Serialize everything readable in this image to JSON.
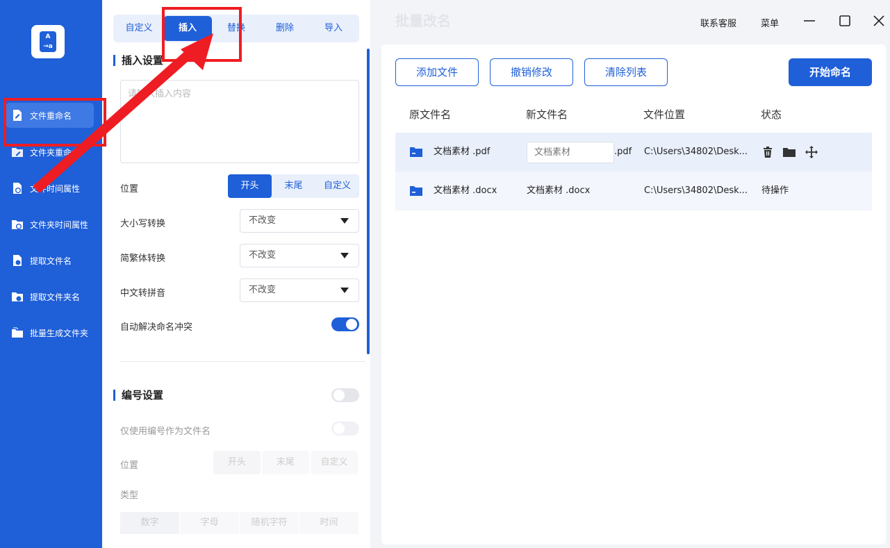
{
  "sidebar": {
    "items": [
      {
        "label": "文件重命名",
        "active": true
      },
      {
        "label": "文件夹重命名",
        "active": false
      },
      {
        "label": "文件时间属性",
        "active": false
      },
      {
        "label": "文件夹时间属性",
        "active": false
      },
      {
        "label": "提取文件名",
        "active": false
      },
      {
        "label": "提取文件夹名",
        "active": false
      },
      {
        "label": "批量生成文件夹",
        "active": false
      }
    ]
  },
  "panel": {
    "tabs": [
      "自定义",
      "插入",
      "替换",
      "删除",
      "导入"
    ],
    "active_tab": "插入",
    "insert_title": "插入设置",
    "insert_placeholder": "请输入插入内容",
    "position_label": "位置",
    "position_options": [
      "开头",
      "末尾",
      "自定义"
    ],
    "position_selected": "开头",
    "case_label": "大小写转换",
    "case_value": "不改变",
    "trad_label": "简繁体转换",
    "trad_value": "不改变",
    "pinyin_label": "中文转拼音",
    "pinyin_value": "不改变",
    "conflict_label": "自动解决命名冲突",
    "conflict_on": true,
    "numbering_title": "编号设置",
    "numbering_only_label": "仅使用编号作为文件名",
    "num_position_label": "位置",
    "num_position_options": [
      "开头",
      "末尾",
      "自定义"
    ],
    "type_label": "类型",
    "type_options": [
      "数字",
      "字母",
      "随机字符",
      "时间"
    ]
  },
  "header": {
    "title": "批量改名",
    "contact": "联系客服",
    "menu": "菜单"
  },
  "toolbar": {
    "add_files": "添加文件",
    "undo": "撤销修改",
    "clear": "清除列表",
    "start": "开始命名"
  },
  "table": {
    "columns": [
      "原文件名",
      "新文件名",
      "文件位置",
      "状态"
    ],
    "rows": [
      {
        "original": "文档素材 .pdf",
        "new_input": "文档素材",
        "new_ext": ".pdf",
        "location": "C:\\Users\\34802\\Desk...",
        "status": ""
      },
      {
        "original": "文档素材 .docx",
        "new_name": "文档素材 .docx",
        "location": "C:\\Users\\34802\\Desk...",
        "status": "待操作"
      }
    ]
  },
  "colors": {
    "brand": "#1f5fd8",
    "annotation": "#ee1d23"
  }
}
